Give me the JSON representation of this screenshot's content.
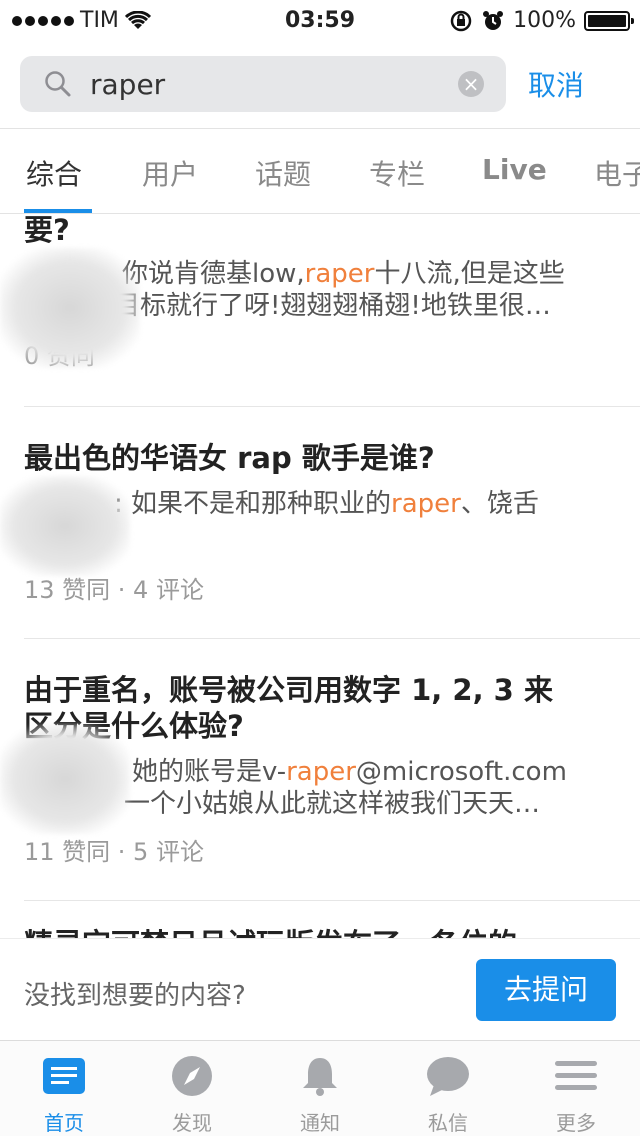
{
  "status_bar": {
    "carrier": "TIM",
    "time": "03:59",
    "battery": "100%"
  },
  "search": {
    "query": "raper",
    "cancel_label": "取消"
  },
  "tabs": [
    {
      "label": "综合"
    },
    {
      "label": "用户"
    },
    {
      "label": "话题"
    },
    {
      "label": "专栏"
    },
    {
      "label": "Live"
    },
    {
      "label": "电子"
    }
  ],
  "results": [
    {
      "title": "要?",
      "line1_pre": "你说肯德基low,",
      "line1_hl": "raper",
      "line1_post": "十八流,但是这些",
      "line2": "目标就行了呀!翅翅翅桶翅!地铁里很…",
      "meta": "0 赞同"
    },
    {
      "title": "最出色的华语女 rap 歌手是谁?",
      "line1_pre": ": 如果不是和那种职业的",
      "line1_hl": "raper",
      "line1_post": "、饶舌",
      "meta": "13 赞同 · 4 评论"
    },
    {
      "title_line1": "由于重名，账号被公司用数字 1, 2, 3 来",
      "title_line2": "区分是什么体验?",
      "line1_pre": "她的账号是v-",
      "line1_hl": "raper",
      "line1_post": "@microsoft.com",
      "line2": "一个小姑娘从此就这样被我们天天…",
      "meta": "11 赞同 · 5 评论"
    },
    {
      "title": "精灵宝可梦日月试玩版发布了，各位的"
    }
  ],
  "ask_bar": {
    "text": "没找到想要的内容?",
    "button": "去提问"
  },
  "tab_bar": [
    {
      "label": "首页",
      "icon": "home-icon"
    },
    {
      "label": "发现",
      "icon": "compass-icon"
    },
    {
      "label": "通知",
      "icon": "bell-icon"
    },
    {
      "label": "私信",
      "icon": "chat-icon"
    },
    {
      "label": "更多",
      "icon": "menu-icon"
    }
  ],
  "colors": {
    "accent": "#1a8ee8",
    "highlight": "#f0803c"
  }
}
